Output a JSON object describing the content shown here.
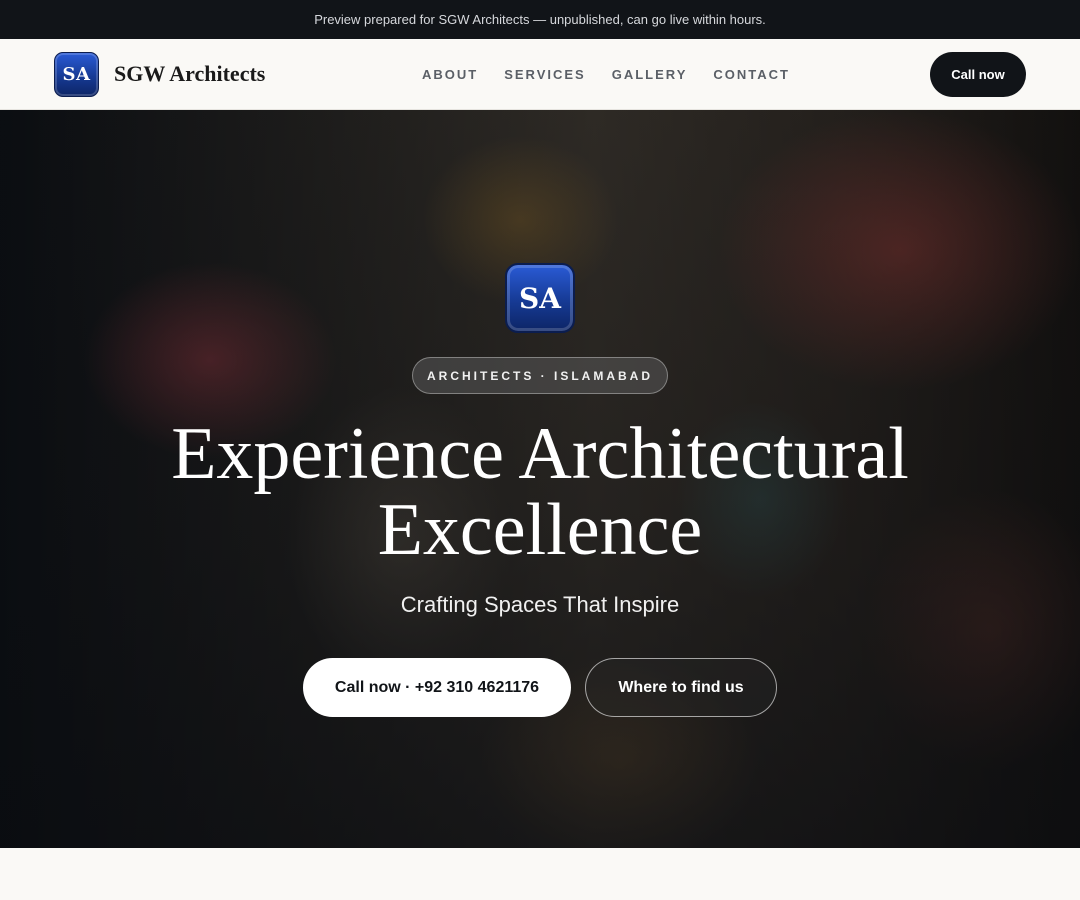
{
  "topbar": {
    "message": "Preview prepared for SGW Architects — unpublished, can go live within hours."
  },
  "nav": {
    "logo_text": "SA",
    "brand_name": "SGW Architects",
    "links": [
      {
        "label": "ABOUT"
      },
      {
        "label": "SERVICES"
      },
      {
        "label": "GALLERY"
      },
      {
        "label": "CONTACT"
      }
    ],
    "call_label": "Call now"
  },
  "hero": {
    "logo_text": "SA",
    "tag": "ARCHITECTS · ISLAMABAD",
    "headline_line1": "Experience Architectural",
    "headline_line2": "Excellence",
    "subtitle": "Crafting Spaces That Inspire",
    "primary_button": "Call now · +92 310 4621176",
    "secondary_button": "Where to find us"
  },
  "colors": {
    "dark": "#111418",
    "logo_blue": "#163a94",
    "page_bg": "#faf9f6"
  },
  "icons": {
    "brand_logo": "sa-monogram-logo"
  }
}
